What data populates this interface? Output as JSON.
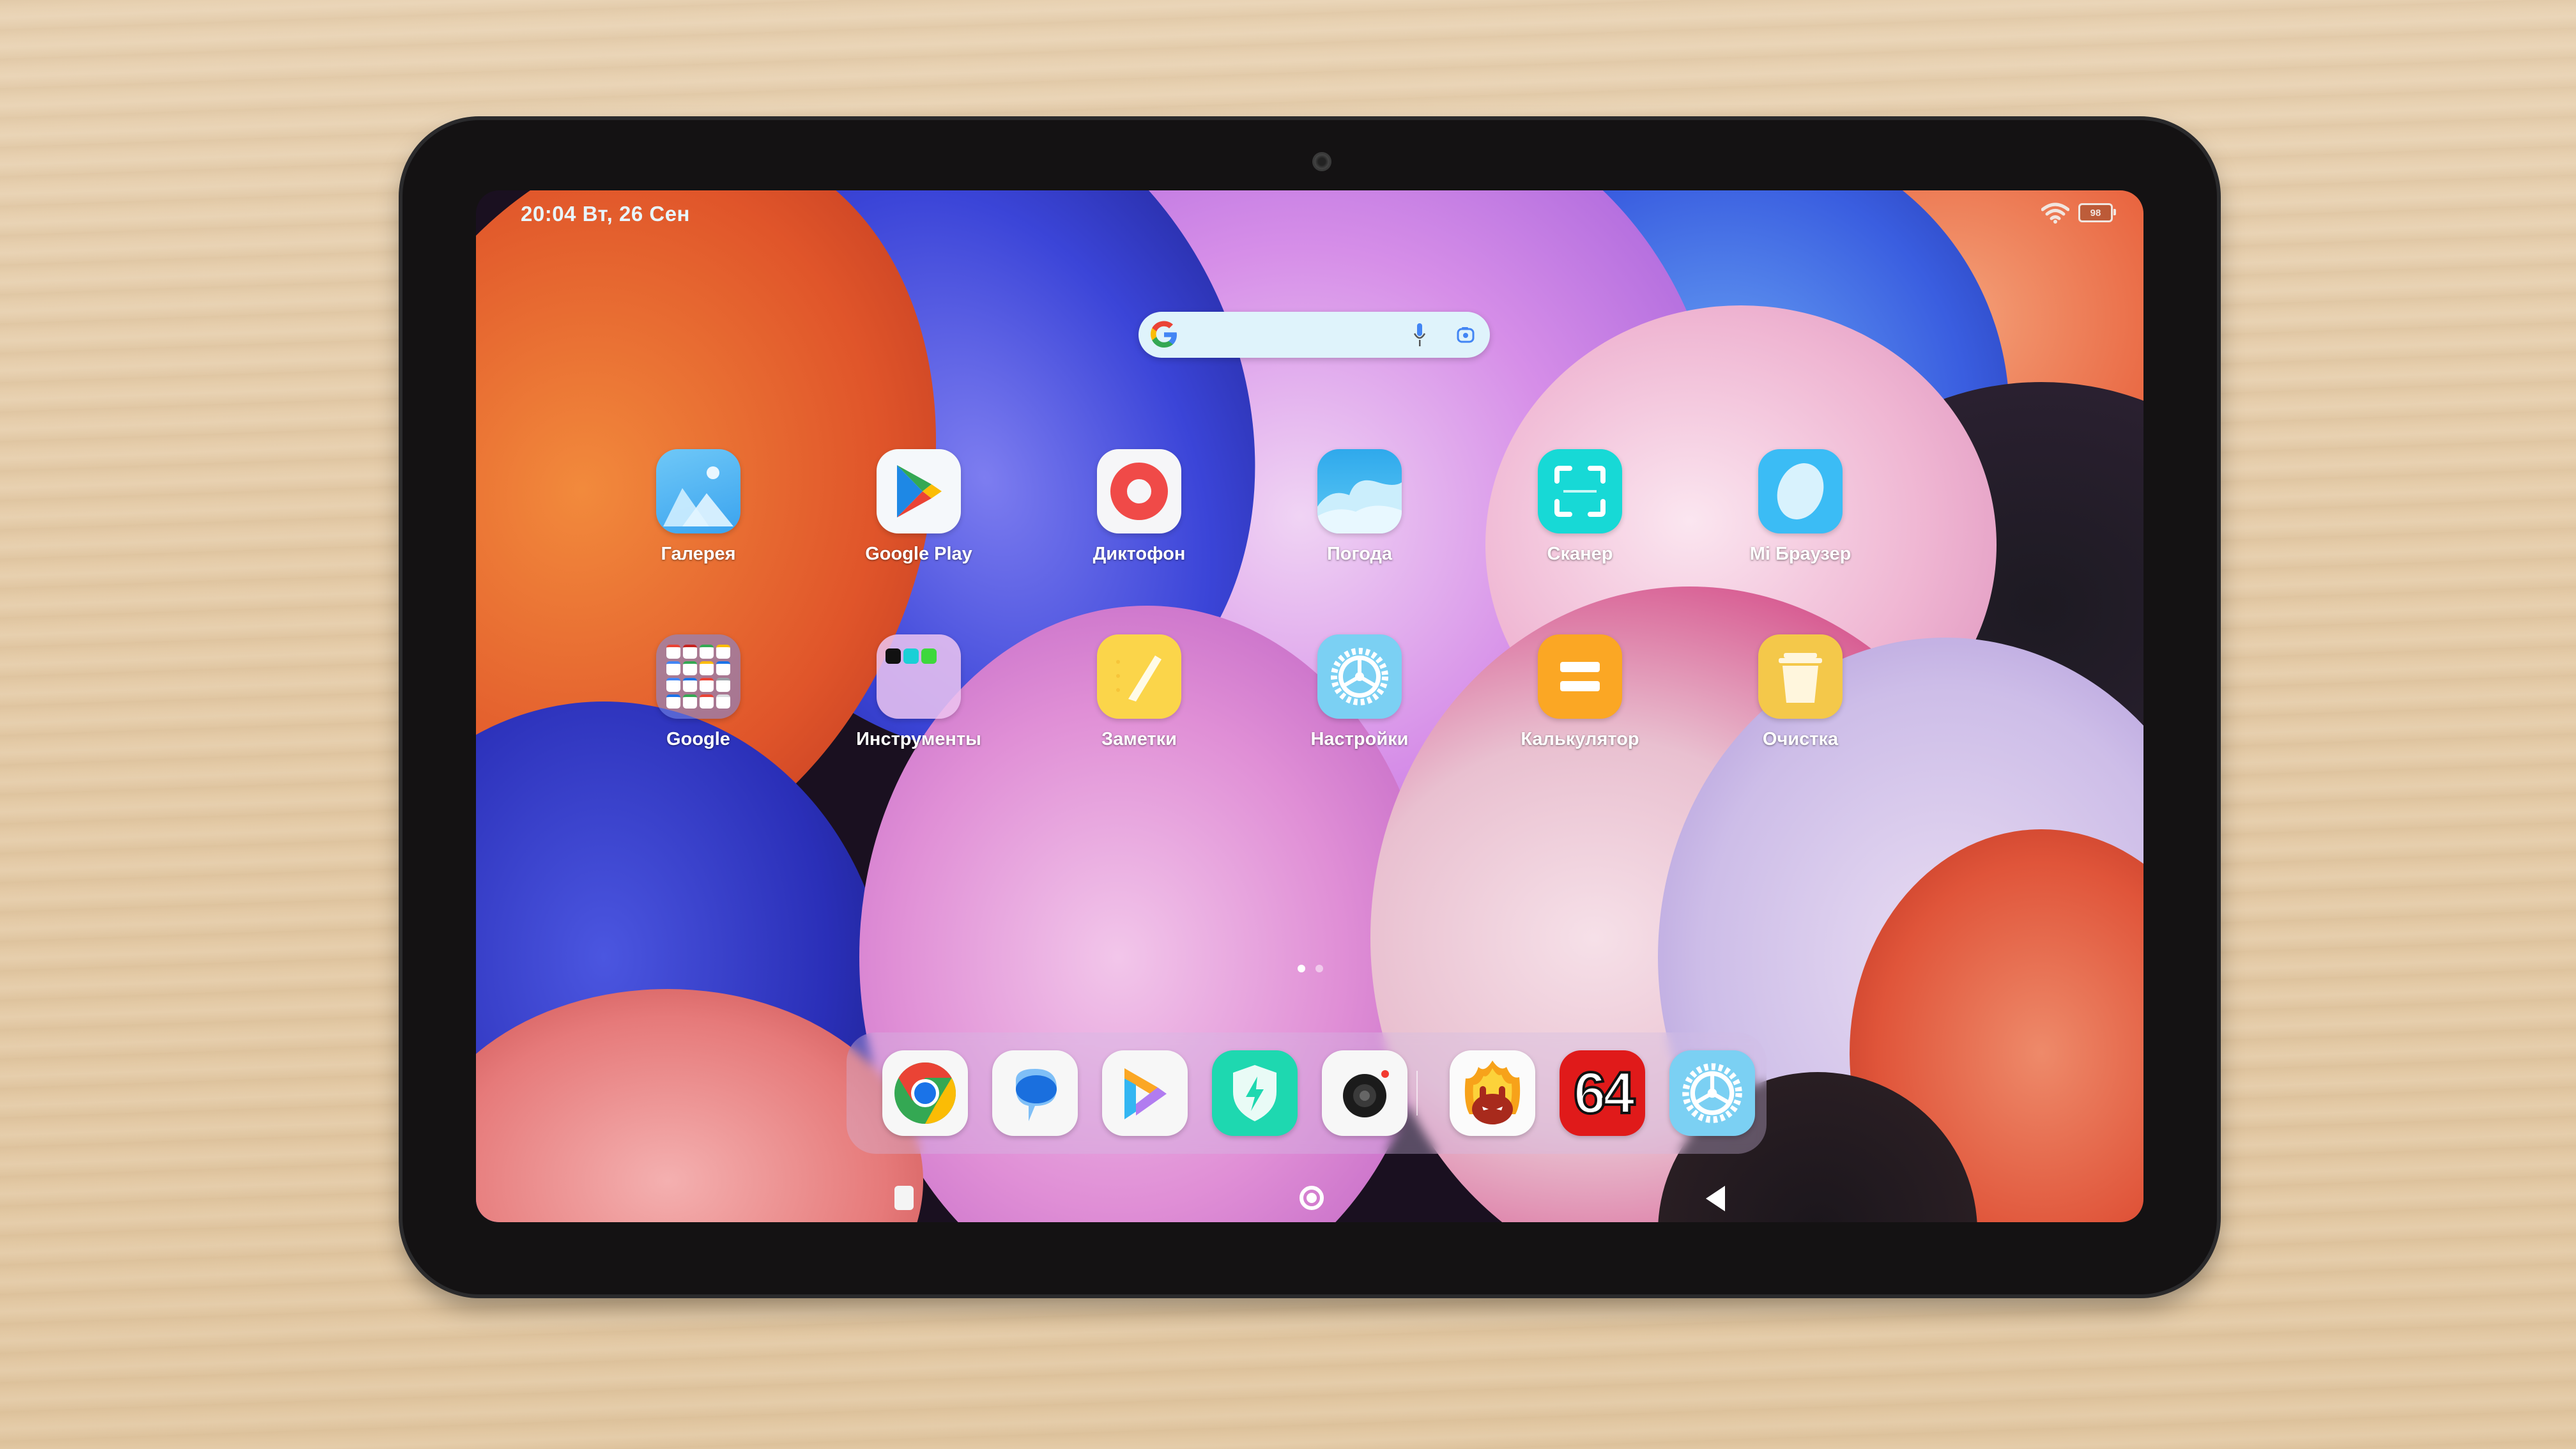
{
  "status_bar": {
    "time_date": "20:04 Вт, 26 Сен",
    "wifi_icon": "wifi-icon",
    "battery_level": "98"
  },
  "search_widget": {
    "logo_icon": "google-g-icon",
    "mic_icon": "microphone-icon",
    "lens_icon": "google-lens-icon"
  },
  "home_grid": {
    "row1": [
      {
        "label": "Галерея",
        "icon": "gallery-icon"
      },
      {
        "label": "Google Play",
        "icon": "google-play-icon"
      },
      {
        "label": "Диктофон",
        "icon": "recorder-icon"
      },
      {
        "label": "Погода",
        "icon": "weather-icon"
      },
      {
        "label": "Сканер",
        "icon": "scanner-icon"
      },
      {
        "label": "Mi Браузер",
        "icon": "mi-browser-icon"
      }
    ],
    "row2": [
      {
        "label": "Google",
        "icon": "google-folder-icon"
      },
      {
        "label": "Инструменты",
        "icon": "tools-folder-icon"
      },
      {
        "label": "Заметки",
        "icon": "notes-icon"
      },
      {
        "label": "Настройки",
        "icon": "settings-icon"
      },
      {
        "label": "Калькулятор",
        "icon": "calculator-icon"
      },
      {
        "label": "Очистка",
        "icon": "cleaner-icon"
      }
    ]
  },
  "page_indicator": {
    "pages": 2,
    "active": 1
  },
  "dock": {
    "apps": [
      {
        "name": "Chrome",
        "icon": "chrome-icon"
      },
      {
        "name": "Messages",
        "icon": "messages-icon"
      },
      {
        "name": "Mi Video",
        "icon": "mi-video-icon"
      },
      {
        "name": "Security",
        "icon": "security-icon"
      },
      {
        "name": "Camera",
        "icon": "camera-icon"
      },
      {
        "name": "AnTuTu",
        "icon": "antutu-icon"
      },
      {
        "name": "AIDA64",
        "icon": "aida64-icon",
        "text": "64"
      },
      {
        "name": "Settings",
        "icon": "settings-icon"
      }
    ]
  },
  "nav_bar": {
    "recents": "recents-icon",
    "home": "home-icon",
    "back": "back-icon"
  },
  "colors": {
    "aida_red": "#e01a1a",
    "security_green": "#1ed8b0",
    "scanner_cyan": "#17d9d6",
    "calculator_orange": "#fba724",
    "notes_yellow": "#fbd54a"
  }
}
